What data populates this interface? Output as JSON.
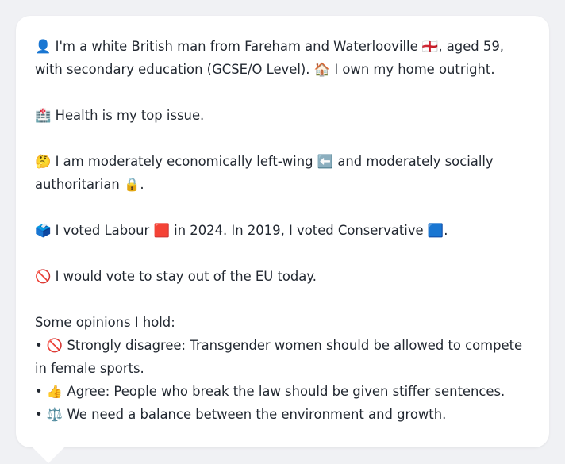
{
  "profile": {
    "p1": {
      "icon": "👤",
      "t1": "I'm a white British man from Fareham and Waterlooville",
      "flag": "🏴󠁧󠁢󠁥󠁮󠁧󠁿",
      "t2": ", aged 59, with secondary education (GCSE/O Level).",
      "home_icon": "🏠",
      "t3": "I own my home outright."
    },
    "p2": {
      "icon": "🏥",
      "text": "Health is my top issue."
    },
    "p3": {
      "icon": "🤔",
      "t1": "I am moderately economically left-wing",
      "left_icon": "⬅️",
      "t2": "and moderately socially authoritarian",
      "lock_icon": "🔒",
      "t3": "."
    },
    "p4": {
      "icon": "🗳️",
      "t1": "I voted Labour",
      "red_icon": "🟥",
      "t2": "in 2024. In 2019, I voted Conservative",
      "blue_icon": "🟦",
      "t3": "."
    },
    "p5": {
      "icon": "🚫",
      "text": "I would vote to stay out of the EU today."
    },
    "opinions": {
      "heading": "Some opinions I hold:",
      "bullet": "•",
      "items": [
        {
          "icon": "🚫",
          "text": "Strongly disagree: Transgender women should be allowed to compete in female sports."
        },
        {
          "icon": "👍",
          "text": "Agree: People who break the law should be given stiffer sentences."
        },
        {
          "icon": "⚖️",
          "text": "We need a balance between the environment and growth."
        }
      ]
    }
  }
}
